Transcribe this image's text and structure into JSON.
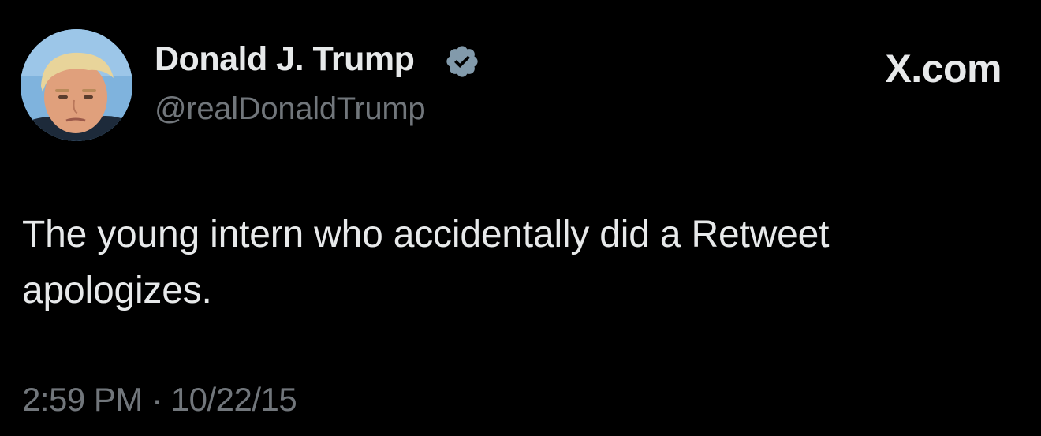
{
  "author": {
    "name": "Donald J. Trump",
    "handle": "@realDonaldTrump",
    "verified": true,
    "badge_color": "#829aab",
    "avatar_icon": "profile-photo"
  },
  "brand": {
    "label": "X.com"
  },
  "tweet": {
    "text": "The young intern who accidentally did a Retweet apologizes.",
    "timestamp": "2:59 PM · 10/22/15"
  },
  "colors": {
    "background": "#000000",
    "primary_text": "#e7e9ea",
    "secondary_text": "#71767b"
  }
}
